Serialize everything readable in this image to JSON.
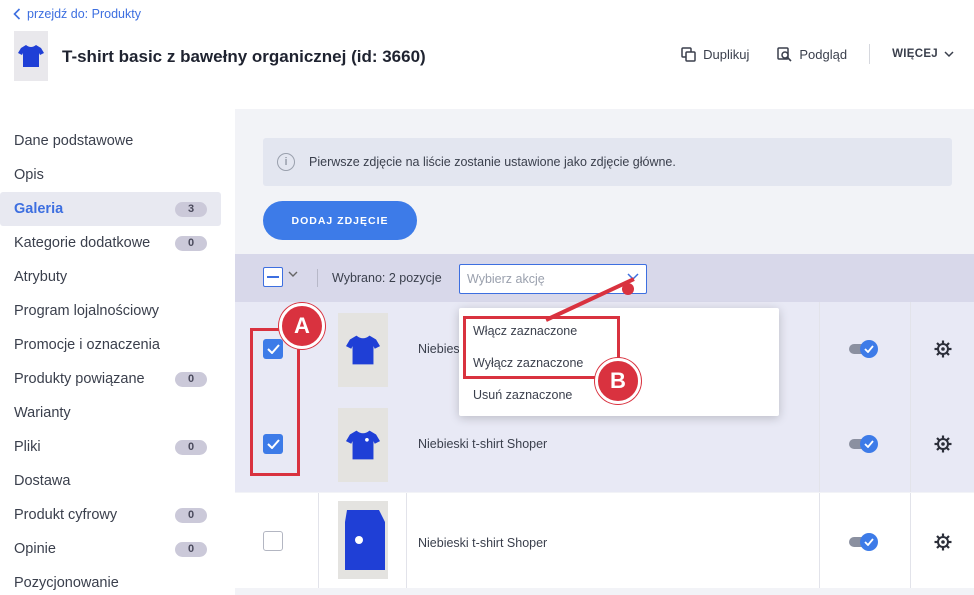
{
  "header": {
    "back_link": "przejdź do: Produkty",
    "title": "T-shirt basic z bawełny organicznej (id: 3660)",
    "actions": {
      "duplicate": "Duplikuj",
      "preview": "Podgląd",
      "more": "WIĘCEJ"
    }
  },
  "sidebar": {
    "items": [
      {
        "label": "Dane podstawowe",
        "badge": ""
      },
      {
        "label": "Opis",
        "badge": ""
      },
      {
        "label": "Galeria",
        "badge": "3",
        "active": true
      },
      {
        "label": "Kategorie dodatkowe",
        "badge": "0"
      },
      {
        "label": "Atrybuty",
        "badge": ""
      },
      {
        "label": "Program lojalnościowy",
        "badge": ""
      },
      {
        "label": "Promocje i oznaczenia",
        "badge": ""
      },
      {
        "label": "Produkty powiązane",
        "badge": "0"
      },
      {
        "label": "Warianty",
        "badge": ""
      },
      {
        "label": "Pliki",
        "badge": "0"
      },
      {
        "label": "Dostawa",
        "badge": ""
      },
      {
        "label": "Produkt cyfrowy",
        "badge": "0"
      },
      {
        "label": "Opinie",
        "badge": "0"
      },
      {
        "label": "Pozycjonowanie",
        "badge": ""
      }
    ]
  },
  "gallery": {
    "info": "Pierwsze zdjęcie na liście zostanie ustawione jako zdjęcie główne.",
    "add_button": "DODAJ ZDJĘCIE",
    "selected_count_text": "Wybrano: 2 pozycje",
    "action_placeholder": "Wybierz akcję",
    "action_options": [
      "Włącz zaznaczone",
      "Wyłącz zaznaczone",
      "Usuń zaznaczone"
    ],
    "rows": [
      {
        "name": "Niebieski t-shirt Shoper",
        "checked": true,
        "enabled": true
      },
      {
        "name": "Niebieski t-shirt Shoper",
        "checked": true,
        "enabled": true
      },
      {
        "name": "Niebieski t-shirt Shoper",
        "checked": false,
        "enabled": true
      }
    ]
  },
  "annotations": {
    "a": "A",
    "b": "B"
  },
  "colors": {
    "accent": "#3d7be8",
    "annotation": "#d9323f",
    "toolbar_bg": "#d8d8ea"
  }
}
